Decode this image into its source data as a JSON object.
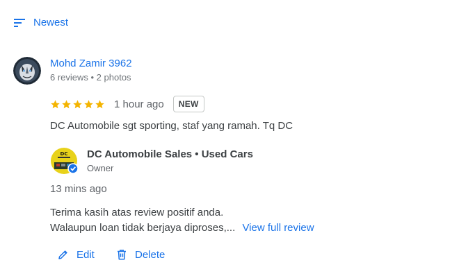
{
  "sort": {
    "label": "Newest",
    "icon": "sort-icon"
  },
  "review": {
    "reviewer_name": "Mohd Zamir 3962",
    "reviewer_meta": "6 reviews • 2 photos",
    "rating": 5,
    "time": "1 hour ago",
    "badge": "NEW",
    "text": "DC Automobile sgt sporting, staf yang ramah. Tq DC"
  },
  "owner_reply": {
    "name": "DC Automobile Sales • Used Cars",
    "role": "Owner",
    "time": "13 mins ago",
    "line1": "Terima kasih atas review positif anda.",
    "line2": "Walaupun loan tidak berjaya diproses,...",
    "view_full": "View full review"
  },
  "actions": {
    "edit_label": "Edit",
    "delete_label": "Delete"
  },
  "colors": {
    "accent": "#1a73e8",
    "star": "#f4b400",
    "verified": "#1a73e8"
  }
}
